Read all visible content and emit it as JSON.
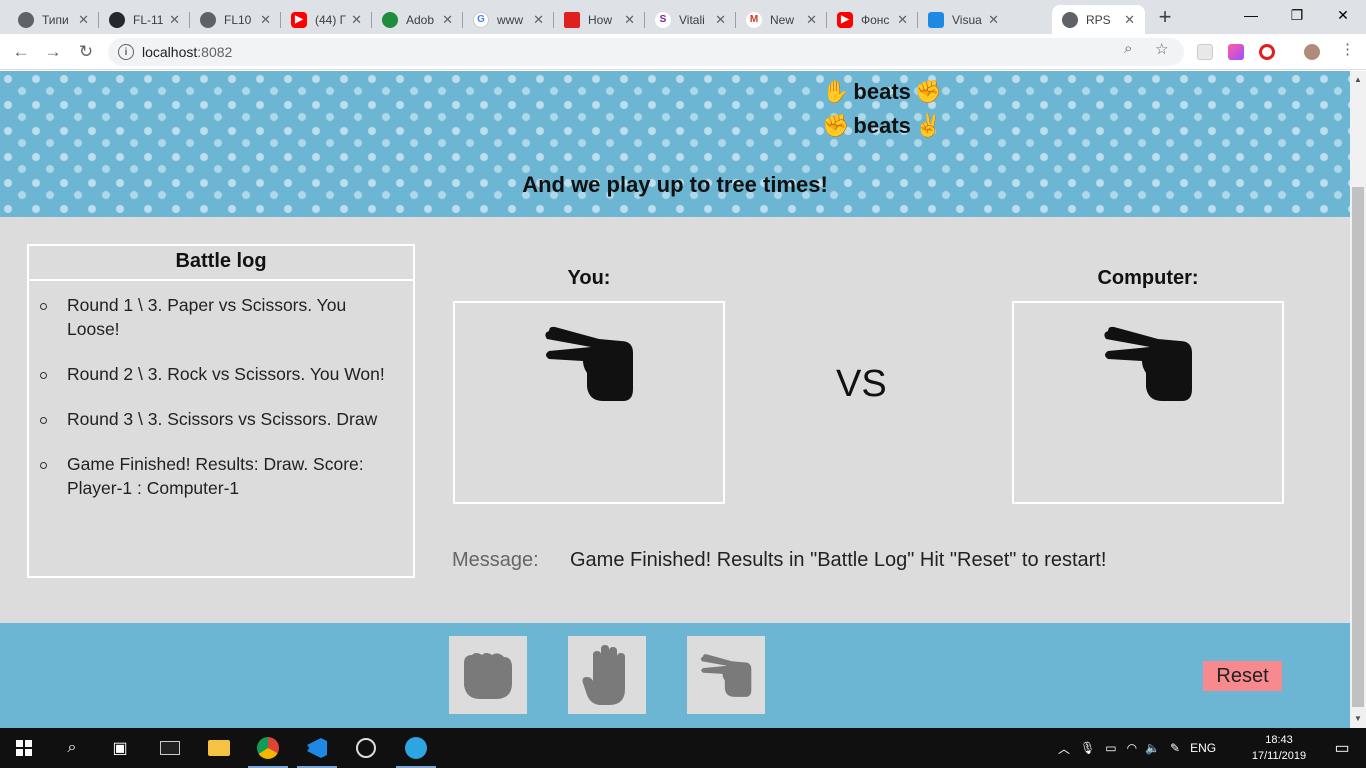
{
  "browser": {
    "tabs": [
      {
        "title": "Типи",
        "color": "#5f6368"
      },
      {
        "title": "FL-11",
        "color": "#24292e"
      },
      {
        "title": "FL10",
        "color": "#5f6368"
      },
      {
        "title": "(44) Г",
        "color": "#ff0000"
      },
      {
        "title": "Adob",
        "color": "#1e8e3e"
      },
      {
        "title": "www",
        "color": "#4285f4"
      },
      {
        "title": "How",
        "color": "#e02020"
      },
      {
        "title": "Vitali",
        "color": "#7b1fa2"
      },
      {
        "title": "New",
        "color": "#d93025"
      },
      {
        "title": "Фонс",
        "color": "#ff0000"
      },
      {
        "title": "Visua",
        "color": "#1e88e5"
      },
      {
        "title": "RPS",
        "color": "#5f6368"
      }
    ],
    "url_host": "localhost",
    "url_port": ":8082"
  },
  "page": {
    "rules": [
      {
        "word": "beats"
      },
      {
        "word": "beats"
      }
    ],
    "banner_text": "And we play up to tree times!",
    "battle_log": {
      "title": "Battle log",
      "entries": [
        "Round 1 \\ 3. Paper vs Scissors. You Loose!",
        "Round 2 \\ 3. Rock vs Scissors. You Won!",
        "Round 3 \\ 3. Scissors vs Scissors. Draw",
        "Game Finished! Results: Draw. Score: Player-1 : Computer-1"
      ]
    },
    "you_label": "You:",
    "computer_label": "Computer:",
    "you_hand": "scissors-icon",
    "computer_hand": "scissors-icon",
    "vs_label": "VS",
    "message_label": "Message:",
    "message_text": "Game Finished! Results in \"Battle Log\" Hit \"Reset\" to restart!",
    "controls": {
      "rock": "rock-icon",
      "paper": "paper-icon",
      "scissors": "scissors-icon",
      "reset_label": "Reset"
    },
    "colors": {
      "banner": "#6cb6d4",
      "background": "#dcdcdc",
      "reset": "#f78a8f"
    }
  },
  "taskbar": {
    "lang": "ENG",
    "time": "18:43",
    "date": "17/11/2019"
  }
}
